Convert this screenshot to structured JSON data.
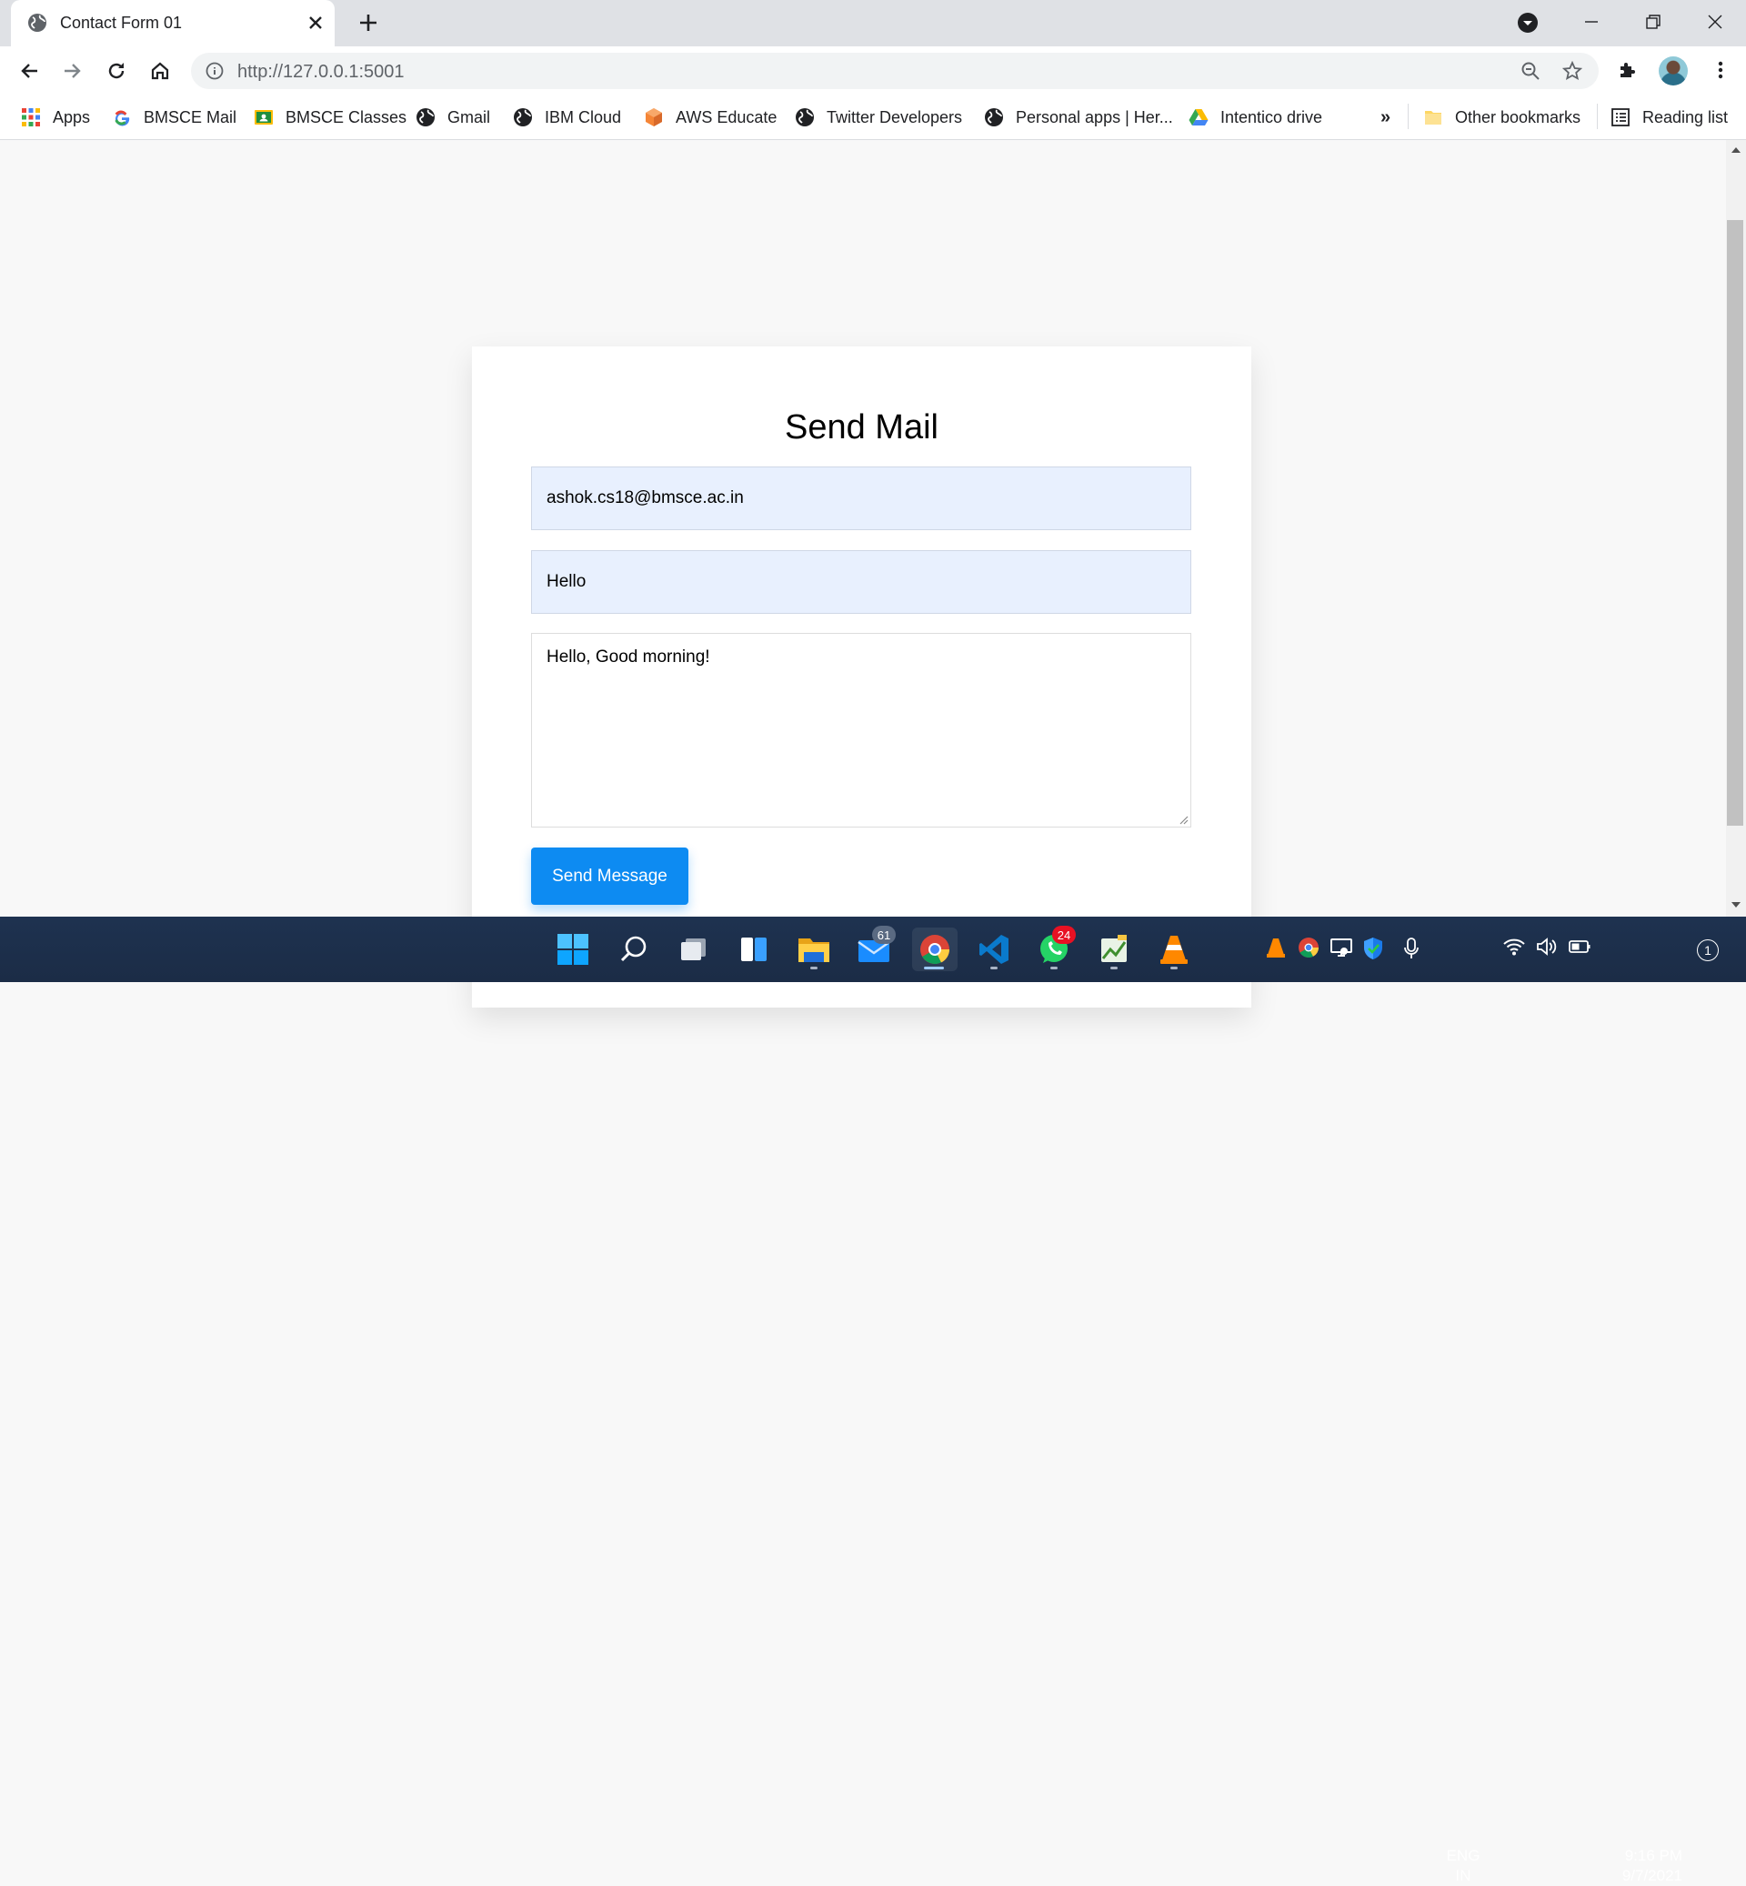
{
  "browser": {
    "tab": {
      "title": "Contact Form 01"
    },
    "url": "http://127.0.0.1:5001"
  },
  "bookmarks": {
    "items": [
      {
        "label": "Apps",
        "icon": "apps-grid-icon"
      },
      {
        "label": "BMSCE Mail",
        "icon": "google-icon"
      },
      {
        "label": "BMSCE Classes",
        "icon": "classroom-icon"
      },
      {
        "label": "Gmail",
        "icon": "globe-icon"
      },
      {
        "label": "IBM Cloud",
        "icon": "globe-icon"
      },
      {
        "label": "AWS Educate",
        "icon": "aws-icon"
      },
      {
        "label": "Twitter Developers",
        "icon": "globe-icon"
      },
      {
        "label": "Personal apps | Her...",
        "icon": "globe-icon"
      },
      {
        "label": "Intentico drive",
        "icon": "drive-icon"
      }
    ],
    "overflow": "»",
    "other_bookmarks": "Other bookmarks",
    "reading_list": "Reading list"
  },
  "form": {
    "title": "Send Mail",
    "email_value": "ashok.cs18@bmsce.ac.in",
    "subject_value": "Hello",
    "message_value": "Hello, Good morning!",
    "submit_label": "Send Message"
  },
  "taskbar": {
    "mail_badge": "61",
    "whatsapp_badge": "24",
    "language": {
      "line1": "ENG",
      "line2": "IN"
    },
    "time": "9:16 PM",
    "date": "9/7/2021",
    "notifications": "1"
  },
  "colors": {
    "accent": "#0d8bf2",
    "autofill": "#e8f0fe",
    "taskbar": "#1e3250"
  }
}
